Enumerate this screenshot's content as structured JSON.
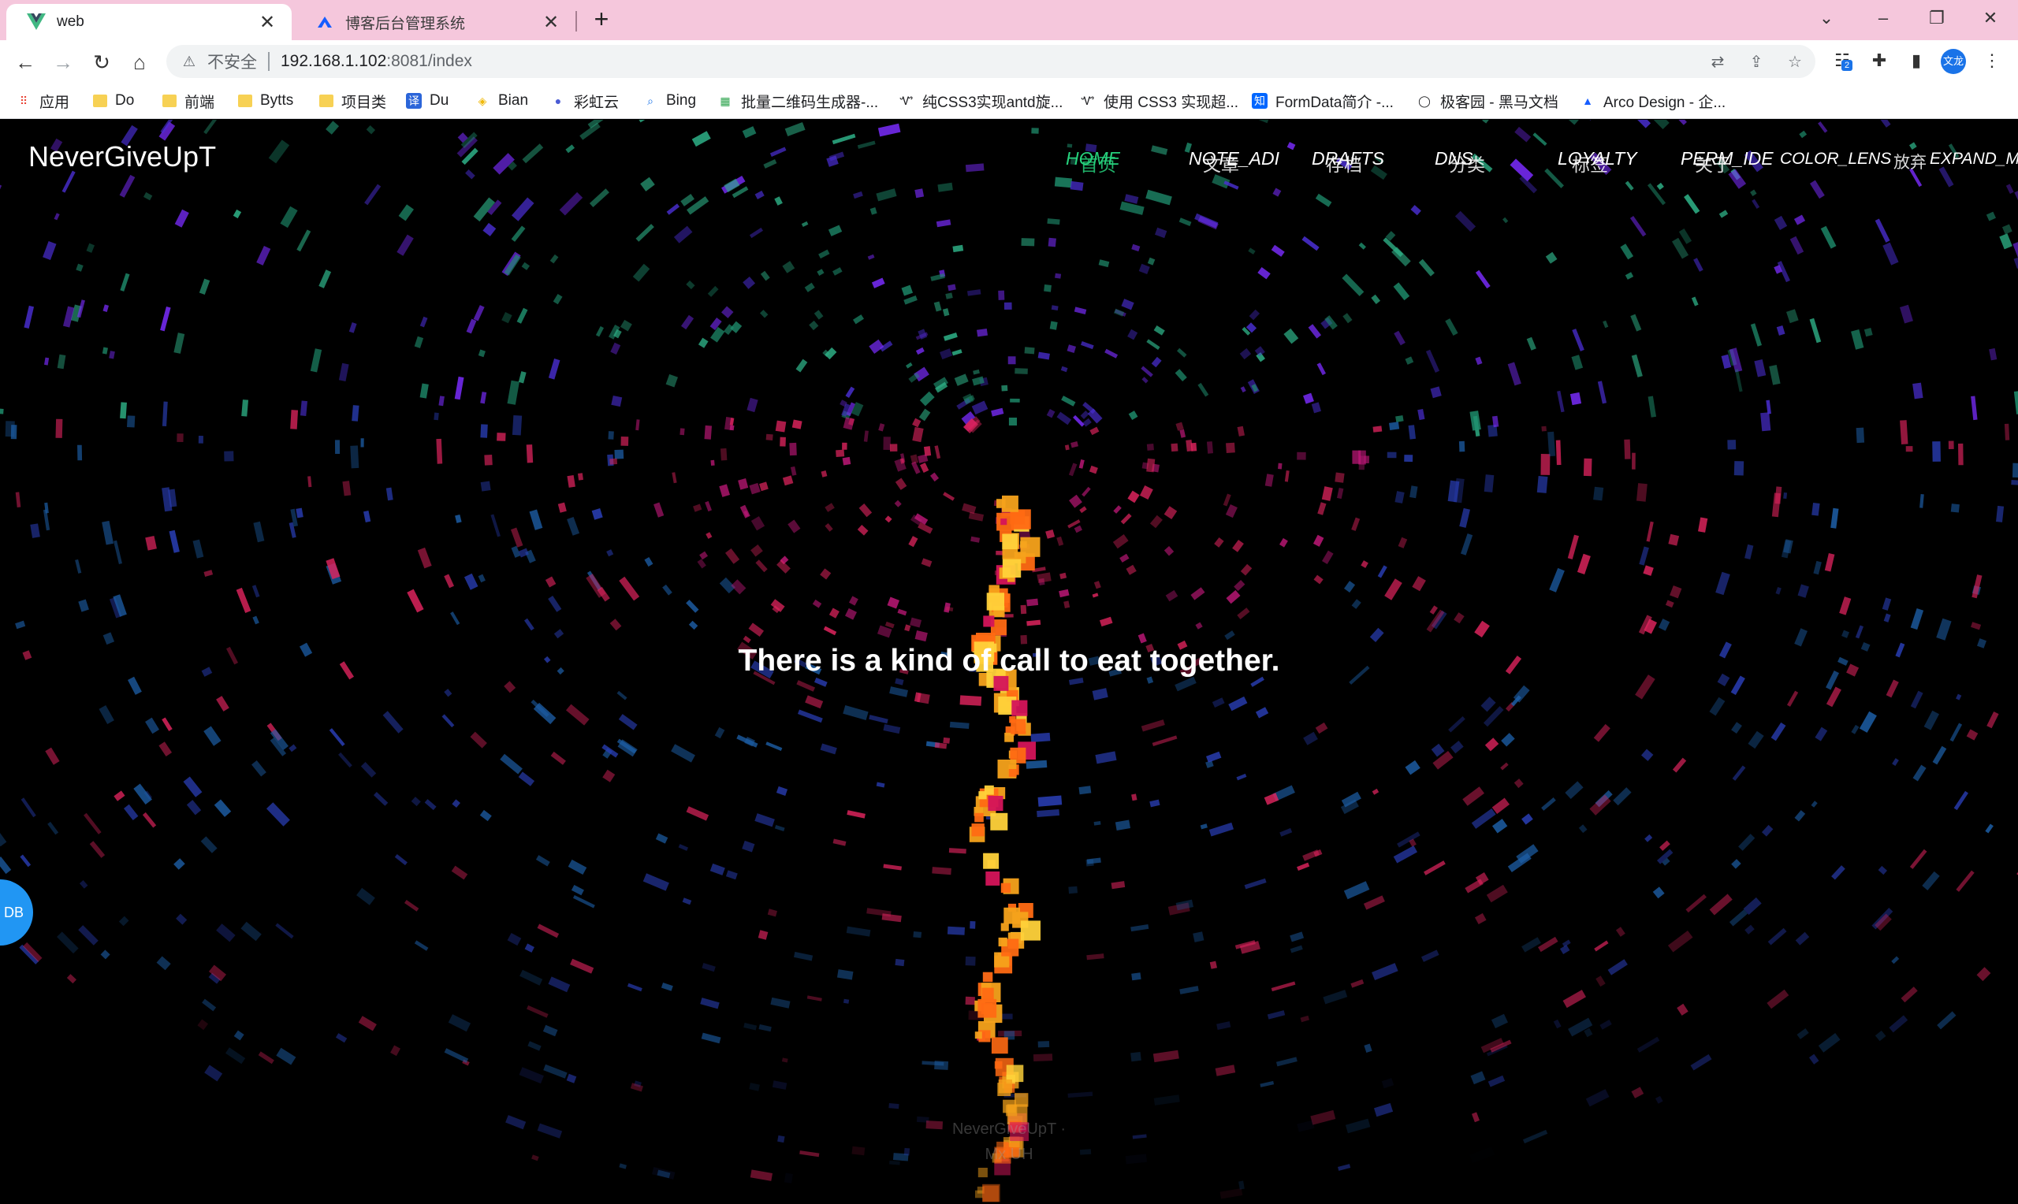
{
  "browser": {
    "tabs": [
      {
        "title": "web",
        "active": true
      },
      {
        "title": "博客后台管理系统",
        "active": false
      }
    ],
    "omnibox": {
      "security_label": "不安全",
      "url_host": "192.168.1.102",
      "url_path": ":8081/index"
    },
    "profile_label": "文龙",
    "extension_badge": "2",
    "bookmarks": [
      {
        "label": "应用",
        "icon": "apps-grid-icon"
      },
      {
        "label": "Do",
        "icon": "folder-icon"
      },
      {
        "label": "前端",
        "icon": "folder-icon"
      },
      {
        "label": "Bytts",
        "icon": "folder-icon"
      },
      {
        "label": "项目类",
        "icon": "folder-icon"
      },
      {
        "label": "Du",
        "icon": "translate-icon"
      },
      {
        "label": "Bian",
        "icon": "binance-icon"
      },
      {
        "label": "彩虹云",
        "icon": "rainbow-cloud-icon"
      },
      {
        "label": "Bing",
        "icon": "search-icon"
      },
      {
        "label": "批量二维码生成器-...",
        "icon": "qr-icon"
      },
      {
        "label": "纯CSS3实现antd旋...",
        "icon": "css-icon"
      },
      {
        "label": "使用 CSS3 实现超...",
        "icon": "css-icon"
      },
      {
        "label": "FormData简介 -...",
        "icon": "zhihu-icon"
      },
      {
        "label": "极客园 - 黑马文档",
        "icon": "globe-icon"
      },
      {
        "label": "Arco Design - 企...",
        "icon": "arco-icon"
      }
    ]
  },
  "site": {
    "title": "NeverGiveUpT",
    "nav": [
      {
        "label": "HOME",
        "overlay": "首页",
        "active": true
      },
      {
        "label": "NOTE_ADI",
        "overlay": "文章",
        "active": false
      },
      {
        "label": "DRAFTS",
        "overlay": "存档",
        "active": false
      },
      {
        "label": "DNS",
        "overlay": "分类",
        "active": false
      },
      {
        "label": "LOYALTY",
        "overlay": "标签",
        "active": false
      },
      {
        "label": "PERM_IDE",
        "overlay": "关于",
        "active": false
      },
      {
        "label": "COLOR_LENS",
        "overlay": "",
        "active": false
      },
      {
        "label": "EXPAND_M",
        "overlay": "放弃",
        "active": false
      }
    ],
    "hero_text": "There is a kind of call to eat together.",
    "fab_label": "DB",
    "footer": [
      "NeverGiveUpT ·",
      "Mx UH"
    ],
    "colors": {
      "accent": "#26d07c",
      "fab": "#2196f3",
      "tab_strip": "#f5c7dc"
    }
  }
}
